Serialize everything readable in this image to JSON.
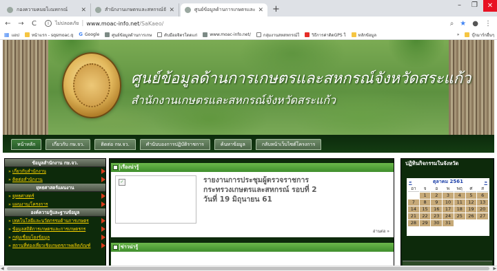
{
  "browser": {
    "tabs": [
      {
        "title": "กองความคมยโเณทกรณ์",
        "active": false
      },
      {
        "title": "สำนักงานเกษตรและสหกรณ์จังหวัด | ส",
        "active": false
      },
      {
        "title": "ศูนย์ข้อมูลด้านการเกษตรและสหกรณ์จ",
        "active": true
      }
    ],
    "new_tab_label": "+",
    "close_glyph": "✕",
    "window_controls": {
      "minimize": "–",
      "maximize": "❐",
      "close": "✕"
    },
    "nav": {
      "back": "←",
      "forward": "→",
      "reload": "C"
    },
    "address": {
      "info_glyph": "i",
      "security_label": "ไม่ปลอดภัย",
      "separator": "|",
      "host": "www.moac-info.net",
      "path": "/SaKaeo/"
    },
    "toolbar_right": {
      "search": "⌕",
      "star": "★",
      "account": "●",
      "menu": "⋮"
    },
    "bookmarks": [
      {
        "label": "แอป",
        "icon": "apps-icon"
      },
      {
        "label": "หน้าแรก - sqsmoac.q",
        "icon": "folder-icon"
      },
      {
        "label": "Google",
        "icon": "google-icon"
      },
      {
        "label": "ศูนย์ข้อมูลด้านการเกษ",
        "icon": "site-icon"
      },
      {
        "label": "ดับมืออจิตรโดดแก่",
        "icon": "doc-icon"
      },
      {
        "label": "www.moac-info.net/",
        "icon": "site-icon"
      },
      {
        "label": "กลุ่มงานสหสหกรณ์ใ",
        "icon": "doc-icon"
      },
      {
        "label": "วิธีการค่าติดGPS ใ",
        "icon": "youtube-icon"
      },
      {
        "label": "หลักข้อมูล",
        "icon": "folder-icon"
      },
      {
        "label": "บุ๊กมาร์กอื่นๆ",
        "icon": "folder-icon"
      }
    ],
    "bookmarks_more": "»"
  },
  "site": {
    "banner_title": "ศูนย์ข้อมูลด้านการเกษตรและสหกรณ์จังหวัดสระแก้ว",
    "banner_subtitle": "สำนักงานเกษตรและสหกรณ์จังหวัดสระแก้ว",
    "nav": [
      "หน้าหลัก",
      "เกี่ยวกับ กษ.จว.",
      "ติดต่อ กษ.จว.",
      "ศำนับบองการปฏิบัติราชการ",
      "ค้นหาข้อมูล",
      "กลับหน้าเว็บไซต์โครงการ"
    ],
    "left_menu": [
      {
        "type": "head",
        "label": "ข้อมูลสำนักงาน กษ.จว."
      },
      {
        "type": "item",
        "label": "เกี่ยวกับสำนักงาน"
      },
      {
        "type": "item",
        "label": "ติดต่อสำนักงาน"
      },
      {
        "type": "head",
        "label": "ยุทธศาสตร์แผนงาน"
      },
      {
        "type": "item",
        "label": "ยุทธศาสตร์"
      },
      {
        "type": "item",
        "label": "แผนงาน/โครงการ"
      },
      {
        "type": "head",
        "label": "องค์ความรู้และฐานข้อมูล"
      },
      {
        "type": "item",
        "label": "เทคโนโลยีและนวัตกรรมด้านการเกษตร"
      },
      {
        "type": "item",
        "label": "ข้อมูลสถิติการเกษตรและการเกษตรกร"
      },
      {
        "type": "item",
        "label": "กลุ่มเชื่อมโยงข้อมูล"
      },
      {
        "type": "item",
        "label": "สถานที่ท่องเที่ยวเชิงเกษตรภาพผลิตภัณฑ์"
      }
    ],
    "panel1": {
      "heading": "เรื่องน่ารู้",
      "news_title": "รายงานการประชุมผู้ตรวจราชการกระทรวงเกษตรและสหกรณ์ รอบที่ 2 วันที่ 19 มิถุนายน 61",
      "read_more": "อ่านต่อ »",
      "broken_image_glyph": "✓"
    },
    "panel2": {
      "heading": "ข่าวน่ารู้"
    },
    "calendar": {
      "heading": "ปฏิทินกิจกรรมในจังหวัด",
      "prev": "«",
      "next": "»",
      "month_label": "ตุลาคม 2561",
      "dow": [
        "อา",
        "จ",
        "อ",
        "พ",
        "พฤ",
        "ศ",
        "ส"
      ],
      "weeks": [
        [
          "",
          "1",
          "2",
          "3",
          "4",
          "5",
          "6"
        ],
        [
          "7",
          "8",
          "9",
          "10",
          "11",
          "12",
          "13"
        ],
        [
          "14",
          "15",
          "16",
          "17",
          "18",
          "19",
          "20"
        ],
        [
          "21",
          "22",
          "23",
          "24",
          "25",
          "26",
          "27"
        ],
        [
          "28",
          "29",
          "30",
          "31",
          "",
          "",
          ""
        ]
      ]
    },
    "scroll_glyphs": {
      "left": "◀",
      "right": "▶"
    }
  }
}
